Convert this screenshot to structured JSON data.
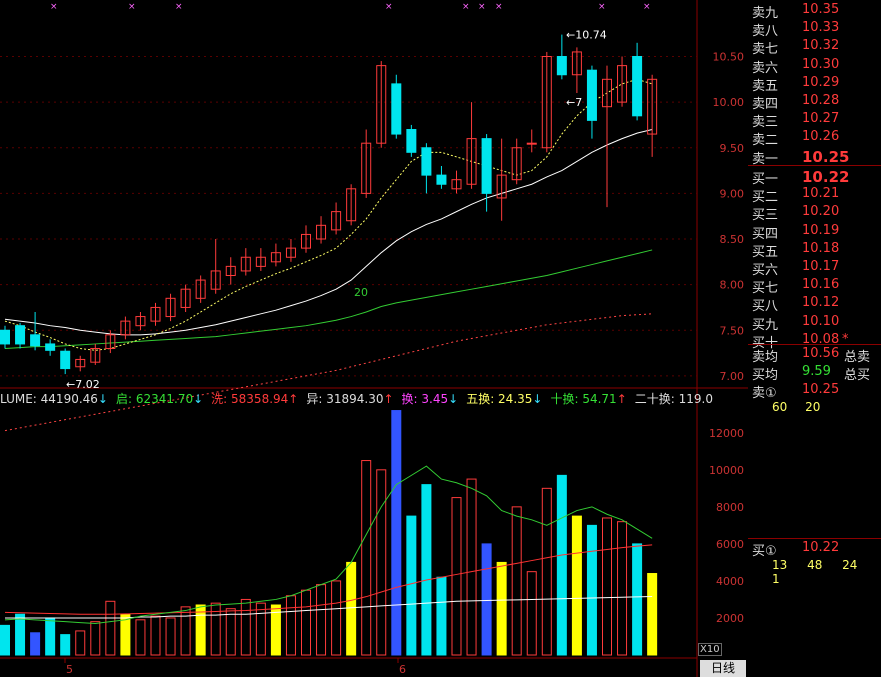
{
  "order_book": {
    "sell": [
      {
        "label": "卖九",
        "price": "10.35"
      },
      {
        "label": "卖八",
        "price": "10.33"
      },
      {
        "label": "卖七",
        "price": "10.32"
      },
      {
        "label": "卖六",
        "price": "10.30"
      },
      {
        "label": "卖五",
        "price": "10.29"
      },
      {
        "label": "卖四",
        "price": "10.28"
      },
      {
        "label": "卖三",
        "price": "10.27"
      },
      {
        "label": "卖二",
        "price": "10.26"
      },
      {
        "label": "卖一",
        "price": "10.25"
      }
    ],
    "buy": [
      {
        "label": "买一",
        "price": "10.22"
      },
      {
        "label": "买二",
        "price": "10.21"
      },
      {
        "label": "买三",
        "price": "10.20"
      },
      {
        "label": "买四",
        "price": "10.19"
      },
      {
        "label": "买五",
        "price": "10.18"
      },
      {
        "label": "买六",
        "price": "10.17"
      },
      {
        "label": "买七",
        "price": "10.16"
      },
      {
        "label": "买八",
        "price": "10.12"
      },
      {
        "label": "买九",
        "price": "10.10"
      },
      {
        "label": "买十",
        "price": "10.08",
        "mark": "*"
      }
    ],
    "avg_sell": {
      "label": "卖均",
      "value": "10.56",
      "tail": "总卖"
    },
    "avg_buy": {
      "label": "买均",
      "value": "9.59",
      "tail": "总买"
    },
    "sell1": {
      "label": "卖①",
      "value": "10.25",
      "nums": [
        "60",
        "20"
      ]
    },
    "buy1": {
      "label": "买①",
      "value": "10.22",
      "nums": [
        "13",
        "48",
        "24",
        "1"
      ]
    }
  },
  "indicators": [
    {
      "text": "LUME: 44190.46",
      "arrow": "↓",
      "color": "#dddddd"
    },
    {
      "text": "启: 62341.70",
      "arrow": "↓",
      "color": "#35e035"
    },
    {
      "text": "洗: 58358.94",
      "arrow": "↑",
      "color": "#ff3b3b"
    },
    {
      "text": "异: 31894.30",
      "arrow": "↑",
      "color": "#dddddd"
    },
    {
      "text": "换: 3.45",
      "arrow": "↓",
      "color": "#ff44ff"
    },
    {
      "text": "五换: 24.35",
      "arrow": "↓",
      "color": "#ffff66"
    },
    {
      "text": "十换: 54.71",
      "arrow": "↑",
      "color": "#35e035"
    },
    {
      "text": "二十换: 119.0",
      "arrow": "",
      "color": "#dddddd"
    }
  ],
  "ui": {
    "x10": "X10",
    "day_button": "日线"
  },
  "chart_data": {
    "type": "candlestick",
    "price_axis": {
      "ticks": [
        "10.50",
        "10.00",
        "9.50",
        "9.00",
        "8.50",
        "8.00",
        "7.50",
        "7.00"
      ],
      "range": [
        6.9,
        10.9
      ]
    },
    "volume_axis": {
      "ticks": [
        "12000",
        "10000",
        "8000",
        "6000",
        "4000",
        "2000"
      ],
      "range": [
        0,
        13500
      ]
    },
    "date_labels": [
      {
        "index": 2,
        "text": "5"
      },
      {
        "index": 13,
        "text": "6"
      }
    ],
    "annotations": [
      {
        "index": 2,
        "price": 7.02,
        "text": "7.02"
      },
      {
        "index": 18,
        "price": 10.74,
        "text": "10.74"
      },
      {
        "index": 18,
        "price": 10.0,
        "text": "7"
      }
    ],
    "ma_label": {
      "index": 12,
      "price": 7.92,
      "text": "20"
    },
    "up_color": "#ff3b3b",
    "down_color": "#00e5ee",
    "candles": [
      {
        "o": 7.5,
        "c": 7.35,
        "h": 7.55,
        "l": 7.3,
        "v": 1600
      },
      {
        "o": 7.55,
        "c": 7.35,
        "h": 7.58,
        "l": 7.3,
        "v": 2200
      },
      {
        "o": 7.45,
        "c": 7.33,
        "h": 7.7,
        "l": 7.28,
        "v": 1200
      },
      {
        "o": 7.35,
        "c": 7.28,
        "h": 7.4,
        "l": 7.22,
        "v": 2000
      },
      {
        "o": 7.27,
        "c": 7.08,
        "h": 7.3,
        "l": 7.02,
        "v": 1100
      },
      {
        "o": 7.1,
        "c": 7.18,
        "h": 7.22,
        "l": 7.05,
        "v": 1300
      },
      {
        "o": 7.15,
        "c": 7.3,
        "h": 7.35,
        "l": 7.12,
        "v": 1800
      },
      {
        "o": 7.3,
        "c": 7.45,
        "h": 7.5,
        "l": 7.25,
        "v": 2900
      },
      {
        "o": 7.45,
        "c": 7.6,
        "h": 7.65,
        "l": 7.4,
        "v": 2200
      },
      {
        "o": 7.55,
        "c": 7.65,
        "h": 7.7,
        "l": 7.5,
        "v": 1900
      },
      {
        "o": 7.6,
        "c": 7.75,
        "h": 7.8,
        "l": 7.55,
        "v": 2100
      },
      {
        "o": 7.65,
        "c": 7.85,
        "h": 7.9,
        "l": 7.6,
        "v": 2000
      },
      {
        "o": 7.75,
        "c": 7.95,
        "h": 8.0,
        "l": 7.7,
        "v": 2600
      },
      {
        "o": 7.85,
        "c": 8.05,
        "h": 8.1,
        "l": 7.8,
        "v": 2700
      },
      {
        "o": 7.95,
        "c": 8.15,
        "h": 8.5,
        "l": 7.9,
        "v": 2800
      },
      {
        "o": 8.1,
        "c": 8.2,
        "h": 8.3,
        "l": 8.0,
        "v": 2500
      },
      {
        "o": 8.15,
        "c": 8.3,
        "h": 8.4,
        "l": 8.1,
        "v": 3000
      },
      {
        "o": 8.2,
        "c": 8.3,
        "h": 8.4,
        "l": 8.15,
        "v": 2800
      },
      {
        "o": 8.25,
        "c": 8.35,
        "h": 8.45,
        "l": 8.2,
        "v": 2700
      },
      {
        "o": 8.3,
        "c": 8.4,
        "h": 8.5,
        "l": 8.25,
        "v": 3200
      },
      {
        "o": 8.4,
        "c": 8.55,
        "h": 8.65,
        "l": 8.35,
        "v": 3500
      },
      {
        "o": 8.5,
        "c": 8.65,
        "h": 8.75,
        "l": 8.45,
        "v": 3800
      },
      {
        "o": 8.6,
        "c": 8.8,
        "h": 8.9,
        "l": 8.55,
        "v": 4000
      },
      {
        "o": 8.7,
        "c": 9.05,
        "h": 9.1,
        "l": 8.65,
        "v": 5000
      },
      {
        "o": 9.0,
        "c": 9.55,
        "h": 9.7,
        "l": 8.95,
        "v": 10500
      },
      {
        "o": 9.55,
        "c": 10.4,
        "h": 10.45,
        "l": 9.5,
        "v": 10000
      },
      {
        "o": 10.2,
        "c": 9.65,
        "h": 10.3,
        "l": 9.6,
        "v": 13200
      },
      {
        "o": 9.7,
        "c": 9.45,
        "h": 9.75,
        "l": 9.4,
        "v": 7500
      },
      {
        "o": 9.5,
        "c": 9.2,
        "h": 9.55,
        "l": 9.0,
        "v": 9200
      },
      {
        "o": 9.2,
        "c": 9.1,
        "h": 9.3,
        "l": 9.05,
        "v": 4200
      },
      {
        "o": 9.05,
        "c": 9.15,
        "h": 9.25,
        "l": 9.0,
        "v": 8500
      },
      {
        "o": 9.1,
        "c": 9.6,
        "h": 10.0,
        "l": 9.05,
        "v": 9500
      },
      {
        "o": 9.6,
        "c": 9.0,
        "h": 9.65,
        "l": 8.8,
        "v": 6000
      },
      {
        "o": 8.95,
        "c": 9.2,
        "h": 9.6,
        "l": 8.7,
        "v": 5000
      },
      {
        "o": 9.15,
        "c": 9.5,
        "h": 9.6,
        "l": 9.1,
        "v": 8000
      },
      {
        "o": 9.55,
        "c": 9.55,
        "h": 9.7,
        "l": 9.45,
        "v": 4500
      },
      {
        "o": 9.5,
        "c": 10.5,
        "h": 10.55,
        "l": 9.45,
        "v": 9000
      },
      {
        "o": 10.5,
        "c": 10.3,
        "h": 10.74,
        "l": 10.25,
        "v": 9700
      },
      {
        "o": 10.3,
        "c": 10.55,
        "h": 10.6,
        "l": 10.1,
        "v": 7500
      },
      {
        "o": 10.35,
        "c": 9.8,
        "h": 10.4,
        "l": 9.6,
        "v": 7000
      },
      {
        "o": 9.95,
        "c": 10.25,
        "h": 10.4,
        "l": 8.85,
        "v": 7400
      },
      {
        "o": 10.0,
        "c": 10.4,
        "h": 10.5,
        "l": 9.95,
        "v": 7200
      },
      {
        "o": 10.5,
        "c": 9.85,
        "h": 10.65,
        "l": 9.8,
        "v": 6000
      },
      {
        "o": 9.65,
        "c": 10.25,
        "h": 10.3,
        "l": 9.4,
        "v": 4400
      }
    ],
    "ma5": [
      7.6,
      7.55,
      7.48,
      7.42,
      7.35,
      7.3,
      7.28,
      7.3,
      7.35,
      7.4,
      7.45,
      7.52,
      7.6,
      7.7,
      7.8,
      7.9,
      7.98,
      8.05,
      8.12,
      8.18,
      8.25,
      8.32,
      8.4,
      8.55,
      8.72,
      8.95,
      9.15,
      9.35,
      9.45,
      9.45,
      9.4,
      9.35,
      9.3,
      9.25,
      9.2,
      9.25,
      9.4,
      9.65,
      9.85,
      10.0,
      10.1,
      10.2,
      10.25,
      10.2
    ],
    "ma10": [
      7.62,
      7.6,
      7.58,
      7.55,
      7.53,
      7.5,
      7.48,
      7.46,
      7.45,
      7.45,
      7.46,
      7.48,
      7.5,
      7.53,
      7.56,
      7.6,
      7.64,
      7.68,
      7.72,
      7.77,
      7.82,
      7.88,
      7.95,
      8.05,
      8.2,
      8.35,
      8.48,
      8.58,
      8.66,
      8.72,
      8.8,
      8.88,
      8.95,
      9.0,
      9.05,
      9.1,
      9.18,
      9.25,
      9.35,
      9.45,
      9.53,
      9.6,
      9.66,
      9.7
    ],
    "ma20": [
      7.3,
      7.31,
      7.32,
      7.32,
      7.33,
      7.34,
      7.35,
      7.36,
      7.37,
      7.38,
      7.39,
      7.4,
      7.41,
      7.42,
      7.43,
      7.45,
      7.47,
      7.49,
      7.51,
      7.53,
      7.55,
      7.58,
      7.61,
      7.65,
      7.7,
      7.76,
      7.8,
      7.83,
      7.86,
      7.89,
      7.92,
      7.95,
      7.98,
      8.01,
      8.04,
      8.07,
      8.1,
      8.14,
      8.18,
      8.22,
      8.26,
      8.3,
      8.34,
      8.38
    ],
    "ma60": [
      6.4,
      6.43,
      6.46,
      6.49,
      6.52,
      6.55,
      6.58,
      6.61,
      6.64,
      6.67,
      6.7,
      6.73,
      6.76,
      6.79,
      6.82,
      6.85,
      6.88,
      6.91,
      6.94,
      6.97,
      7.0,
      7.03,
      7.06,
      7.1,
      7.14,
      7.18,
      7.22,
      7.26,
      7.3,
      7.34,
      7.38,
      7.41,
      7.44,
      7.47,
      7.5,
      7.53,
      7.56,
      7.58,
      7.6,
      7.62,
      7.64,
      7.66,
      7.67,
      7.68
    ],
    "vol_ma_green": [
      1900,
      1950,
      1900,
      1850,
      1800,
      1750,
      1700,
      1800,
      1900,
      2100,
      2200,
      2300,
      2400,
      2600,
      2700,
      2750,
      2800,
      2900,
      3000,
      3200,
      3500,
      3800,
      4100,
      5000,
      6500,
      8000,
      9200,
      9700,
      10200,
      9500,
      9300,
      9000,
      8600,
      7800,
      7500,
      7300,
      7000,
      7400,
      7800,
      8000,
      7600,
      7300,
      6800,
      6300
    ],
    "vol_ma_red": [
      2300,
      2280,
      2260,
      2240,
      2220,
      2200,
      2200,
      2200,
      2220,
      2240,
      2260,
      2280,
      2300,
      2320,
      2350,
      2380,
      2400,
      2450,
      2500,
      2550,
      2600,
      2700,
      2800,
      2950,
      3150,
      3400,
      3650,
      3850,
      4050,
      4200,
      4350,
      4500,
      4650,
      4800,
      4950,
      5100,
      5250,
      5400,
      5500,
      5600,
      5700,
      5800,
      5880,
      5950
    ],
    "vol_ma_white": [
      2000,
      2000,
      2000,
      2000,
      2000,
      2000,
      2000,
      2000,
      2000,
      2050,
      2050,
      2100,
      2100,
      2150,
      2150,
      2200,
      2200,
      2250,
      2300,
      2350,
      2400,
      2450,
      2500,
      2550,
      2600,
      2650,
      2700,
      2750,
      2800,
      2850,
      2900,
      2920,
      2940,
      2960,
      2980,
      3000,
      3020,
      3040,
      3060,
      3080,
      3100,
      3120,
      3140,
      3160
    ]
  }
}
